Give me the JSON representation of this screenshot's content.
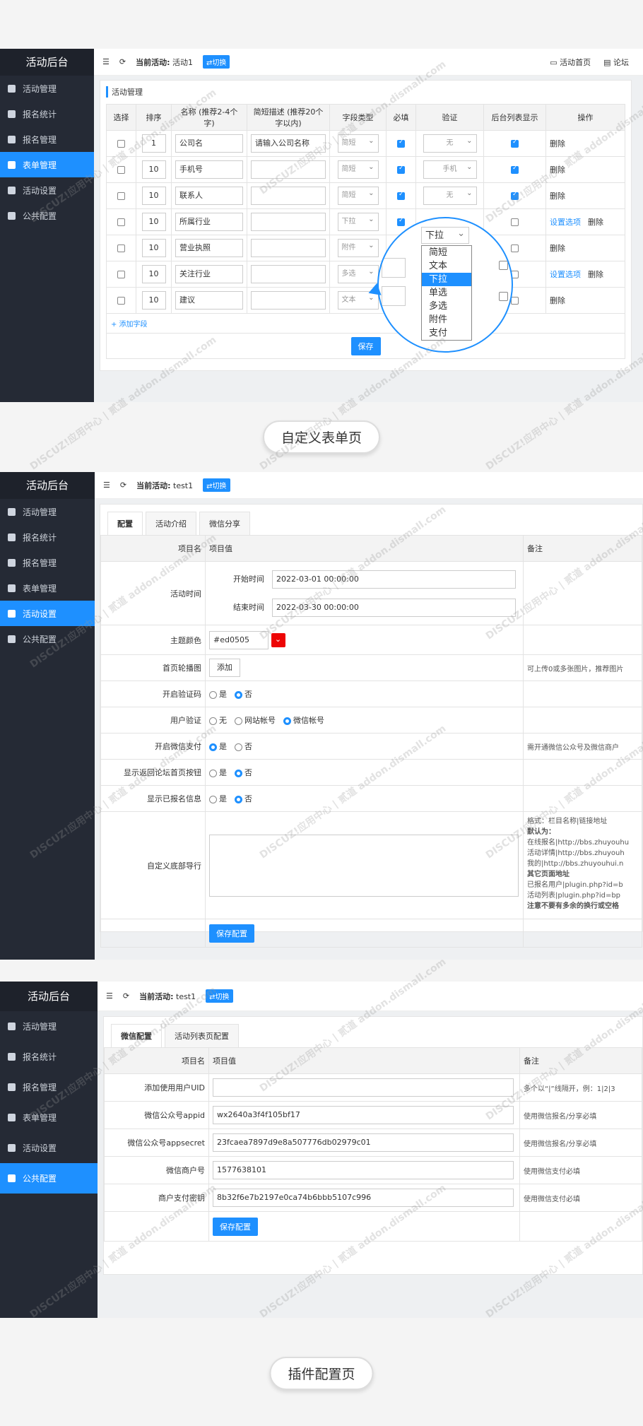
{
  "common": {
    "brand": "活动后台",
    "sidebar": [
      "活动管理",
      "报名统计",
      "报名管理",
      "表单管理",
      "活动设置",
      "公共配置"
    ],
    "switch_label": "⇄切换",
    "current_prefix": "当前活动:",
    "home_link": "活动首页",
    "forum_link": "论坛",
    "watermark": "DISCUZ!应用中心 | 贰道 addon.dismall.com"
  },
  "panel1": {
    "current": "活动1",
    "title": "活动管理",
    "headers": [
      "选择",
      "排序",
      "名称 (推荐2-4个字)",
      "简短描述 (推荐20个字以内)",
      "字段类型",
      "必填",
      "验证",
      "后台列表显示",
      "操作"
    ],
    "rows": [
      {
        "order": "1",
        "name": "公司名",
        "desc": "请输入公司名称",
        "type": "简短",
        "required": true,
        "verify": "无",
        "show": true,
        "ops": [
          "删除"
        ]
      },
      {
        "order": "10",
        "name": "手机号",
        "desc": "",
        "type": "简短",
        "required": true,
        "verify": "手机",
        "show": true,
        "ops": [
          "删除"
        ]
      },
      {
        "order": "10",
        "name": "联系人",
        "desc": "",
        "type": "简短",
        "required": true,
        "verify": "无",
        "show": true,
        "ops": [
          "删除"
        ]
      },
      {
        "order": "10",
        "name": "所属行业",
        "desc": "",
        "type": "下拉",
        "required": true,
        "verify": "",
        "show": false,
        "ops": [
          "设置选项",
          "删除"
        ]
      },
      {
        "order": "10",
        "name": "营业执照",
        "desc": "",
        "type": "附件",
        "required": false,
        "verify": "",
        "show": false,
        "ops": [
          "删除"
        ]
      },
      {
        "order": "10",
        "name": "关注行业",
        "desc": "",
        "type": "多选",
        "required": false,
        "verify": "",
        "show": false,
        "ops": [
          "设置选项",
          "删除"
        ]
      },
      {
        "order": "10",
        "name": "建议",
        "desc": "",
        "type": "文本",
        "required": false,
        "verify": "",
        "show": false,
        "ops": [
          "删除"
        ]
      }
    ],
    "add_field": "+ 添加字段",
    "save": "保存",
    "zoom_selected": "下拉",
    "zoom_options": [
      "简短",
      "文本",
      "下拉",
      "单选",
      "多选",
      "附件",
      "支付"
    ],
    "caption": "自定义表单页"
  },
  "panel2": {
    "current": "test1",
    "tabs": [
      "配置",
      "活动介绍",
      "微信分享"
    ],
    "headers": [
      "项目名",
      "项目值",
      "备注"
    ],
    "time_label": "活动时间",
    "start_label": "开始时间",
    "start_value": "2022-03-01 00:00:00",
    "end_label": "结束时间",
    "end_value": "2022-03-30 00:00:00",
    "color_label": "主题颜色",
    "color_value": "#ed0505",
    "banner_label": "首页轮播图",
    "banner_btn": "添加",
    "banner_note": "可上传0或多张图片，推荐图片",
    "captcha_label": "开启验证码",
    "yes": "是",
    "no": "否",
    "verify_label": "用户验证",
    "verify_opts": [
      "无",
      "网站帐号",
      "微信帐号"
    ],
    "pay_label": "开启微信支付",
    "pay_note": "需开通微信公众号及微信商户",
    "back_label": "显示返回论坛首页按钮",
    "enrolled_label": "显示已报名信息",
    "footer_label": "自定义底部导行",
    "footer_notes": [
      "格式：栏目名称|链接地址",
      "默认为：",
      "在线报名|http://bbs.zhuyouhu",
      "活动详情|http://bbs.zhuyouh",
      "我的|http://bbs.zhuyouhui.n",
      "其它页面地址",
      "已报名用户|plugin.php?id=b",
      "活动列表|plugin.php?id=bp",
      "注意不要有多余的换行或空格"
    ],
    "save": "保存配置"
  },
  "panel3": {
    "current": "test1",
    "tabs": [
      "微信配置",
      "活动列表页配置"
    ],
    "headers": [
      "项目名",
      "项目值",
      "备注"
    ],
    "rows": [
      {
        "label": "添加使用用户UID",
        "value": "",
        "note": "多个以“|”线隔开，例：1|2|3"
      },
      {
        "label": "微信公众号appid",
        "value": "wx2640a3f4f105bf17",
        "note": "使用微信报名/分享必填"
      },
      {
        "label": "微信公众号appsecret",
        "value": "23fcaea7897d9e8a507776db02979c01",
        "note": "使用微信报名/分享必填"
      },
      {
        "label": "微信商户号",
        "value": "1577638101",
        "note": "使用微信支付必填"
      },
      {
        "label": "商户支付密钥",
        "value": "8b32f6e7b2197e0ca74b6bbb5107c996",
        "note": "使用微信支付必填"
      }
    ],
    "save": "保存配置",
    "caption": "插件配置页"
  },
  "colors": {
    "accent": "#1e90ff",
    "sidebar": "#252a35",
    "theme": "#ed0505"
  }
}
